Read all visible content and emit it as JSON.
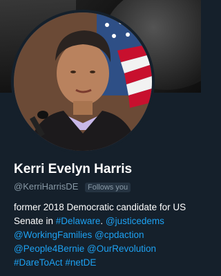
{
  "profile": {
    "name": "Kerri Evelyn Harris",
    "handle": "@KerriHarrisDE",
    "follows_you": "Follows you",
    "bio": {
      "t1": "former 2018 Democratic candidate for US Senate in ",
      "l1": "#Delaware",
      "t2": ". ",
      "l2": "@justicedems",
      "t3": " ",
      "l3": "@WorkingFamilies",
      "t4": " ",
      "l4": "@cpdaction",
      "t5": " ",
      "l5": "@People4Bernie",
      "t6": " ",
      "l6": "@OurRevolution",
      "t7": " ",
      "l7": "#DareToAct",
      "t8": " ",
      "l8": "#netDE"
    }
  },
  "colors": {
    "background": "#15202b",
    "link": "#1da1f2",
    "secondary_text": "#8899a6"
  }
}
